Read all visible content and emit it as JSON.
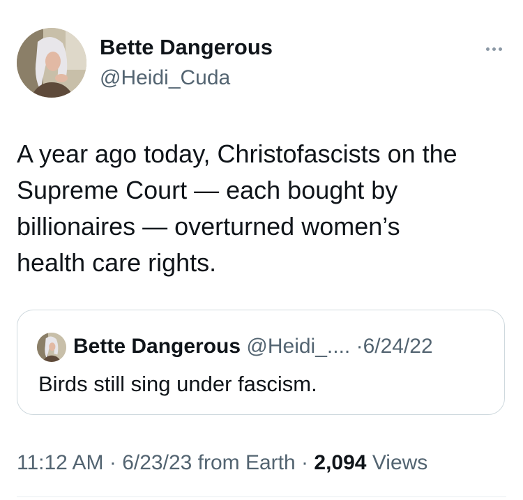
{
  "author": {
    "name": "Bette Dangerous",
    "handle": "@Heidi_Cuda"
  },
  "tweet": {
    "text": "A year ago today, Christofascists on the\nSupreme Court — each bought by\nbillionaires — overturned women’s\nhealth care rights."
  },
  "quoted_tweet": {
    "name": "Bette Dangerous",
    "handle": "@Heidi_....",
    "separator": "·",
    "date": "6/24/22",
    "text": "Birds still sing under fascism."
  },
  "meta": {
    "time": "11:12 AM",
    "sep1": "·",
    "date": "6/23/23",
    "source": "from Earth",
    "sep2": "·",
    "views_count": "2,094",
    "views_label": "Views"
  },
  "icons": {
    "more": "more-horizontal-icon"
  },
  "colors": {
    "text_primary": "#0f1419",
    "text_secondary": "#536471",
    "border": "#cfd9de"
  }
}
